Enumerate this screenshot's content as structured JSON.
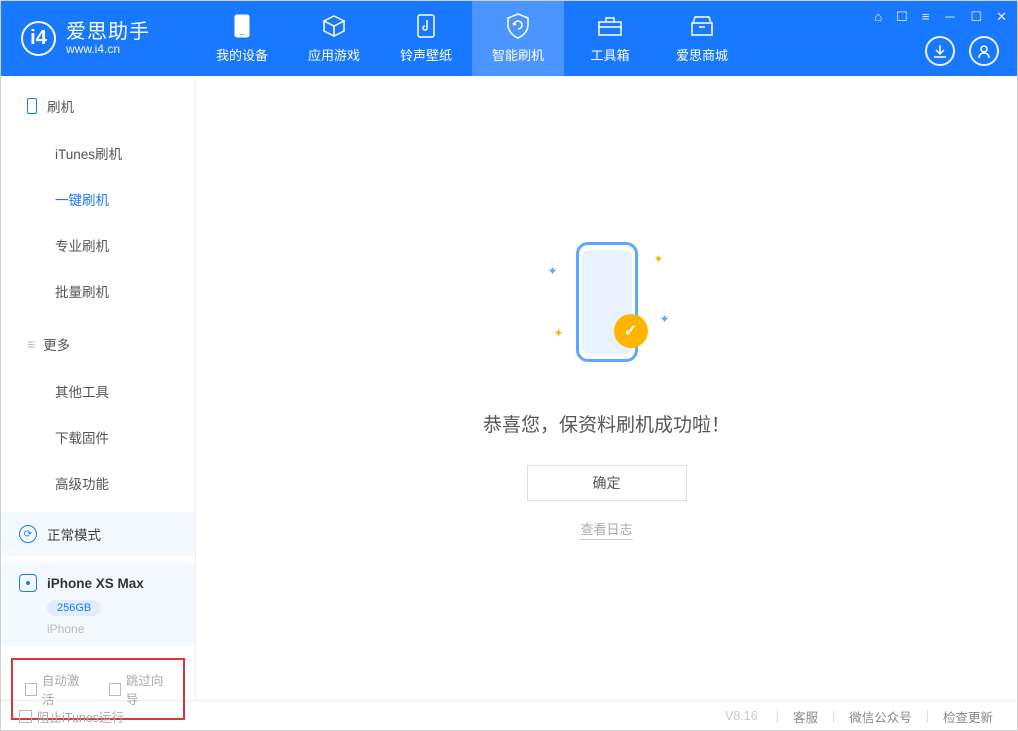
{
  "header": {
    "logo_letter": "i4",
    "logo_title": "爱思助手",
    "logo_url": "www.i4.cn",
    "nav": [
      {
        "id": "mydevice",
        "label": "我的设备"
      },
      {
        "id": "apps",
        "label": "应用游戏"
      },
      {
        "id": "ring",
        "label": "铃声壁纸"
      },
      {
        "id": "flash",
        "label": "智能刷机",
        "active": true
      },
      {
        "id": "tools",
        "label": "工具箱"
      },
      {
        "id": "store",
        "label": "爱思商城"
      }
    ]
  },
  "sidebar": {
    "section_flash": "刷机",
    "flash_items": [
      {
        "id": "itunes",
        "label": "iTunes刷机"
      },
      {
        "id": "oneclick",
        "label": "一键刷机",
        "active": true
      },
      {
        "id": "pro",
        "label": "专业刷机"
      },
      {
        "id": "batch",
        "label": "批量刷机"
      }
    ],
    "section_more": "更多",
    "more_items": [
      {
        "id": "other",
        "label": "其他工具"
      },
      {
        "id": "firmware",
        "label": "下载固件"
      },
      {
        "id": "adv",
        "label": "高级功能"
      }
    ],
    "mode_label": "正常模式",
    "device_name": "iPhone XS Max",
    "device_storage": "256GB",
    "device_type": "iPhone",
    "cb_auto_activate": "自动激活",
    "cb_skip_guide": "跳过向导"
  },
  "main": {
    "success": "恭喜您，保资料刷机成功啦！",
    "ok": "确定",
    "view_log": "查看日志"
  },
  "footer": {
    "stop_itunes": "阻止iTunes运行",
    "version": "V8.16",
    "links": [
      "客服",
      "微信公众号",
      "检查更新"
    ]
  },
  "colors": {
    "brand": "#1878ff",
    "accent": "#ffb400"
  }
}
